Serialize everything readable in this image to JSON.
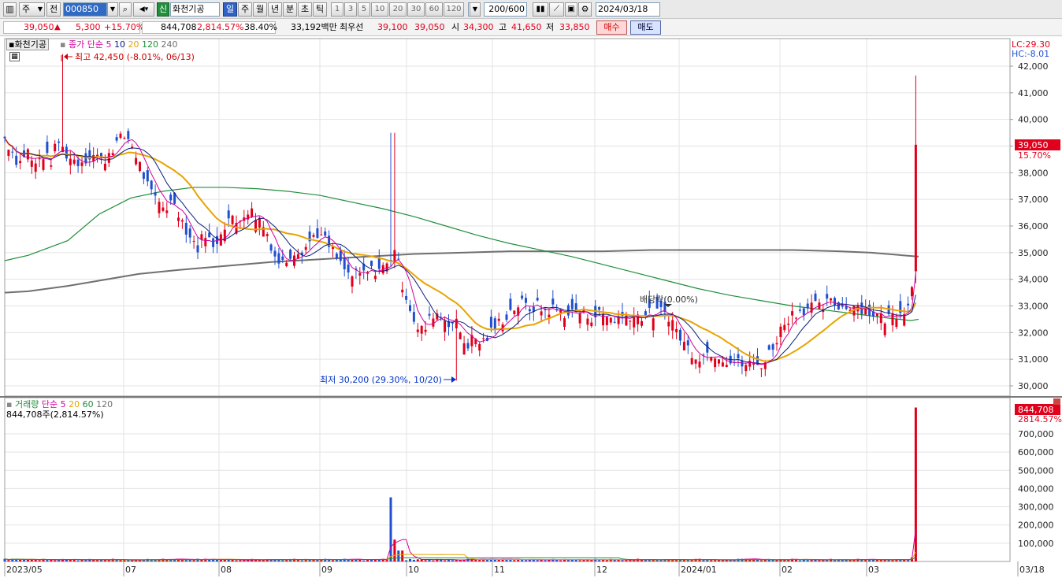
{
  "toolbar": {
    "market_select": "주",
    "prev_label": "전",
    "code_value": "000850",
    "company_badge": "신",
    "company_name": "화천기공",
    "period_buttons": [
      "일",
      "주",
      "월",
      "년",
      "분",
      "초",
      "틱"
    ],
    "interval_buttons": [
      "1",
      "3",
      "5",
      "10",
      "20",
      "30",
      "60",
      "120"
    ],
    "count_value": "200",
    "count_max": "/600",
    "date_value": "2024/03/18"
  },
  "quote": {
    "price": "39,050",
    "arrow": "▲",
    "change": "5,300",
    "change_pct": "+15.70%",
    "volume": "844,708",
    "volume_pct": "2,814.57%",
    "turnover_pct": "38.40%",
    "amount": "33,192백만",
    "best_ask_label": "최우선",
    "best_ask": "39,100",
    "best_bid": "39,050",
    "open_label": "시",
    "open": "34,300",
    "high_label": "고",
    "high": "41,650",
    "low_label": "저",
    "low": "33,850",
    "buy_label": "매수",
    "sell_label": "매도"
  },
  "price_panel": {
    "name_tag": "화천기공",
    "legend_prefix": "종가 단순",
    "legend_ma": [
      "5",
      "10",
      "20",
      "120",
      "240"
    ],
    "lc": "LC:29.30",
    "hc": "HC:-8.01",
    "max_annotation": "최고 42,450 (-8.01%, 06/13)",
    "min_annotation": "최저 30,200 (29.30%, 10/20)",
    "dividend_annotation": "배당락(0.00%)",
    "last_price_label": "39,050",
    "last_pct_label": "15.70%",
    "y_ticks": [
      "42,000",
      "41,000",
      "40,000",
      "39,000",
      "38,000",
      "37,000",
      "36,000",
      "35,000",
      "34,000",
      "33,000",
      "32,000",
      "31,000",
      "30,000"
    ]
  },
  "volume_panel": {
    "legend_prefix": "거래량",
    "legend_ma_prefix": "단순",
    "legend_ma": [
      "5",
      "20",
      "60",
      "120"
    ],
    "current_text": "844,708주(2,814.57%)",
    "last_label": "844,708",
    "last_pct_label": "2814.57%",
    "y_ticks": [
      "700,000",
      "600,000",
      "500,000",
      "400,000",
      "300,000",
      "200,000",
      "100,000"
    ]
  },
  "x_ticks": [
    "2023/05",
    "07",
    "08",
    "09",
    "10",
    "11",
    "12",
    "2024/01",
    "02",
    "03",
    "03/18"
  ],
  "colors": {
    "up": "#e0001b",
    "down": "#1f4fcf",
    "ma5": "#d4009c",
    "ma10": "#0a1f7a",
    "ma20": "#e8a400",
    "ma120": "#1f8f3a",
    "ma240": "#707070"
  },
  "chart_data": {
    "type": "candlestick",
    "series_ohlc_note": "approximate daily values read from chart",
    "price_ylim": [
      29800,
      42500
    ],
    "volume_ylim": [
      0,
      850000
    ],
    "ma120": [
      [
        0,
        34700
      ],
      [
        30,
        34900
      ],
      [
        80,
        35450
      ],
      [
        120,
        36450
      ],
      [
        160,
        37050
      ],
      [
        200,
        37300
      ],
      [
        240,
        37450
      ],
      [
        280,
        37450
      ],
      [
        320,
        37400
      ],
      [
        360,
        37300
      ],
      [
        400,
        37150
      ],
      [
        440,
        36900
      ],
      [
        480,
        36650
      ],
      [
        520,
        36350
      ],
      [
        560,
        36000
      ],
      [
        600,
        35650
      ],
      [
        640,
        35350
      ],
      [
        680,
        35100
      ],
      [
        720,
        34850
      ],
      [
        760,
        34550
      ],
      [
        800,
        34250
      ],
      [
        840,
        33950
      ],
      [
        880,
        33650
      ],
      [
        920,
        33400
      ],
      [
        960,
        33200
      ],
      [
        1000,
        33000
      ],
      [
        1040,
        32850
      ],
      [
        1080,
        32700
      ],
      [
        1120,
        32550
      ],
      [
        1150,
        32450
      ],
      [
        1160,
        32500
      ]
    ],
    "ma240": [
      [
        0,
        33500
      ],
      [
        30,
        33550
      ],
      [
        80,
        33750
      ],
      [
        120,
        33950
      ],
      [
        170,
        34200
      ],
      [
        220,
        34350
      ],
      [
        280,
        34500
      ],
      [
        340,
        34650
      ],
      [
        400,
        34750
      ],
      [
        460,
        34850
      ],
      [
        520,
        34950
      ],
      [
        580,
        35000
      ],
      [
        640,
        35050
      ],
      [
        700,
        35050
      ],
      [
        760,
        35050
      ],
      [
        820,
        35100
      ],
      [
        880,
        35100
      ],
      [
        940,
        35100
      ],
      [
        1000,
        35100
      ],
      [
        1060,
        35050
      ],
      [
        1100,
        35000
      ],
      [
        1140,
        34900
      ],
      [
        1160,
        34850
      ]
    ]
  }
}
